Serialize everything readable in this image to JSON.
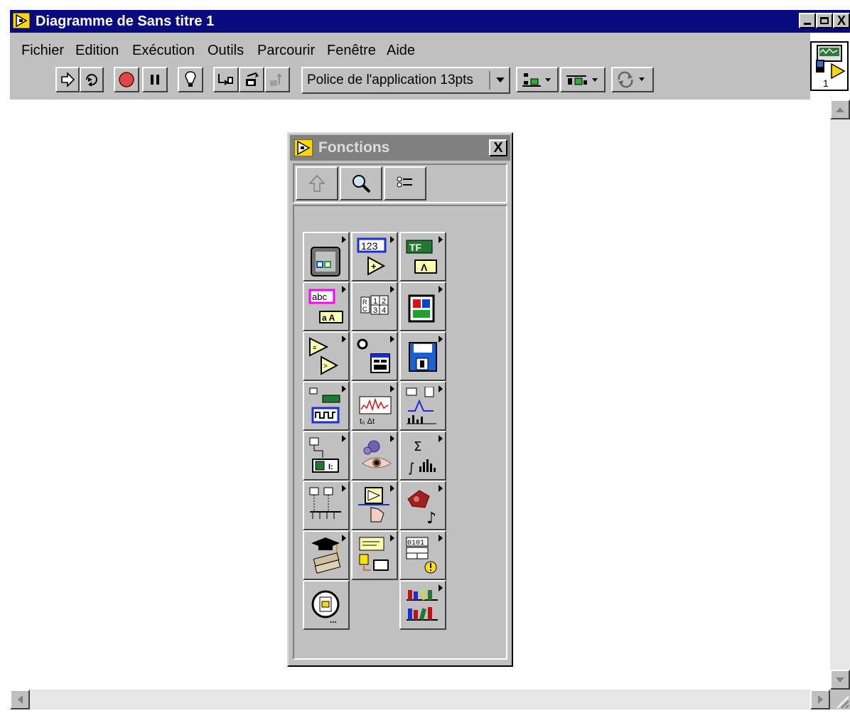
{
  "window": {
    "title": "Diagramme de Sans titre 1",
    "buttons": {
      "minimize": "_",
      "maximize": "□",
      "close": "X"
    }
  },
  "menu": [
    {
      "label": "Fichier"
    },
    {
      "label": "Edition"
    },
    {
      "label": "Exécution"
    },
    {
      "label": "Outils"
    },
    {
      "label": "Parcourir"
    },
    {
      "label": "Fenêtre"
    },
    {
      "label": "Aide"
    }
  ],
  "toolbar": {
    "font": "Police de l'application 13pts",
    "icons": [
      "run-arrow-icon",
      "run-continuously-icon",
      "abort-icon",
      "pause-icon",
      "highlight-execution-icon",
      "retain-wire-values-icon",
      "step-into-icon",
      "step-out-icon",
      "align-icon",
      "distribute-icon",
      "reorder-icon"
    ]
  },
  "vi_icon": {
    "number": "1"
  },
  "palette": {
    "title": "Fonctions",
    "close": "X",
    "toolbar_icons": [
      "up-arrow-icon",
      "search-icon",
      "options-icon"
    ],
    "cells": [
      {
        "name": "structures-icon"
      },
      {
        "name": "numeric-icon",
        "text": "123"
      },
      {
        "name": "boolean-icon",
        "text": "TF"
      },
      {
        "name": "string-icon",
        "text": "abc"
      },
      {
        "name": "array-cluster-icon"
      },
      {
        "name": "comparison-icon"
      },
      {
        "name": "time-dialog-icon"
      },
      {
        "name": "file-io-icon"
      },
      {
        "name": "file-save-icon"
      },
      {
        "name": "data-acquisition-icon"
      },
      {
        "name": "waveform-icon"
      },
      {
        "name": "analyze-icon"
      },
      {
        "name": "instrument-io-icon"
      },
      {
        "name": "motion-vision-icon"
      },
      {
        "name": "mathematics-icon"
      },
      {
        "name": "communication-icon"
      },
      {
        "name": "application-control-icon"
      },
      {
        "name": "graphics-sound-icon"
      },
      {
        "name": "tutorial-icon"
      },
      {
        "name": "report-generation-icon"
      },
      {
        "name": "advanced-icon"
      },
      {
        "name": "select-vi-icon"
      },
      {
        "name": "user-libraries-icon"
      }
    ]
  }
}
